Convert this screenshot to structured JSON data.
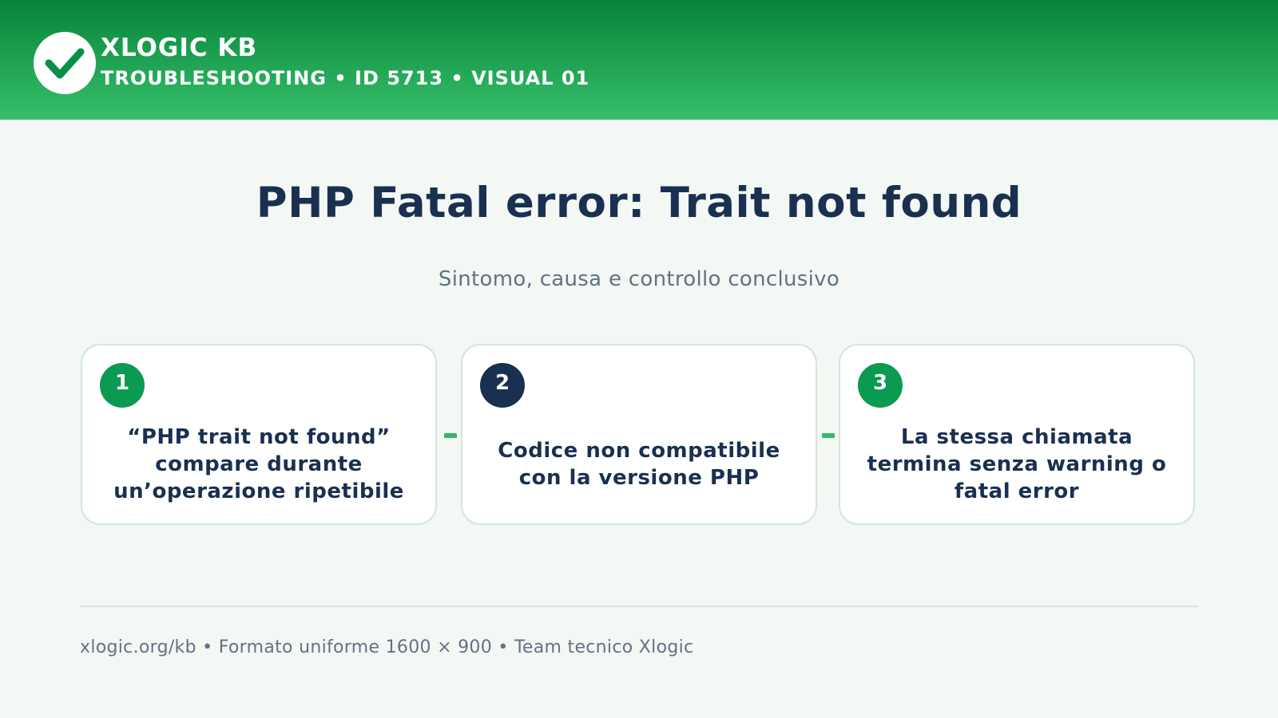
{
  "header": {
    "logo_icon": "checkmark-icon",
    "brand": "XLOGIC KB",
    "meta": "TROUBLESHOOTING • ID 5713 • VISUAL 01",
    "gradient_top": "#06843a",
    "gradient_bottom": "#37bf6a"
  },
  "title": "PHP Fatal error: Trait not found",
  "subtitle": "Sintomo, causa e controllo conclusivo",
  "steps": [
    {
      "number": "1",
      "text": "“PHP trait not found” compare durante un’operazione ripetibile",
      "badge_color": "#0a9a52"
    },
    {
      "number": "2",
      "text": "Codice non compatibile con la versione PHP",
      "badge_color": "#193050"
    },
    {
      "number": "3",
      "text": "La stessa chiamata termina senza warning o fatal error",
      "badge_color": "#0a9a52"
    }
  ],
  "footer": "xlogic.org/kb • Formato uniforme 1600 × 900 • Team tecnico Xlogic",
  "colors": {
    "background": "#f3f8f5",
    "title": "#193050",
    "muted_text": "#5f7383",
    "connector": "#36b86a",
    "card_border": "#d2e6dc"
  }
}
